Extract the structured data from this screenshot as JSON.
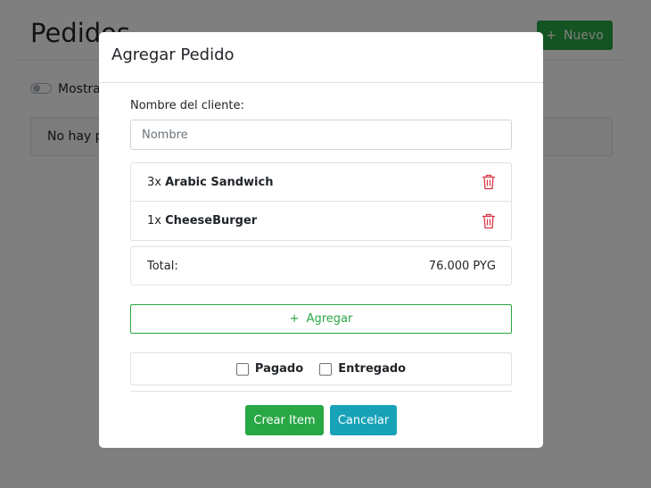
{
  "page": {
    "title": "Pedidos",
    "new_button": {
      "icon": "+",
      "label": "Nuevo"
    },
    "toggle_label": "Mostrar",
    "empty_text": "No hay pedidos"
  },
  "modal": {
    "title": "Agregar Pedido",
    "name_label": "Nombre del cliente:",
    "name_placeholder": "Nombre",
    "name_value": "",
    "items": [
      {
        "qty": "3x",
        "name": "Arabic Sandwich"
      },
      {
        "qty": "1x",
        "name": "CheeseBurger"
      }
    ],
    "total_label": "Total:",
    "total_value": "76.000 PYG",
    "add_button": {
      "icon": "+",
      "label": "Agregar"
    },
    "checks": [
      {
        "label": "Pagado",
        "checked": false
      },
      {
        "label": "Entregado",
        "checked": false
      }
    ],
    "create_button": "Crear Item",
    "cancel_button": "Cancelar"
  },
  "colors": {
    "success": "#28a745",
    "info": "#17a2b8",
    "danger": "#dc3545"
  }
}
